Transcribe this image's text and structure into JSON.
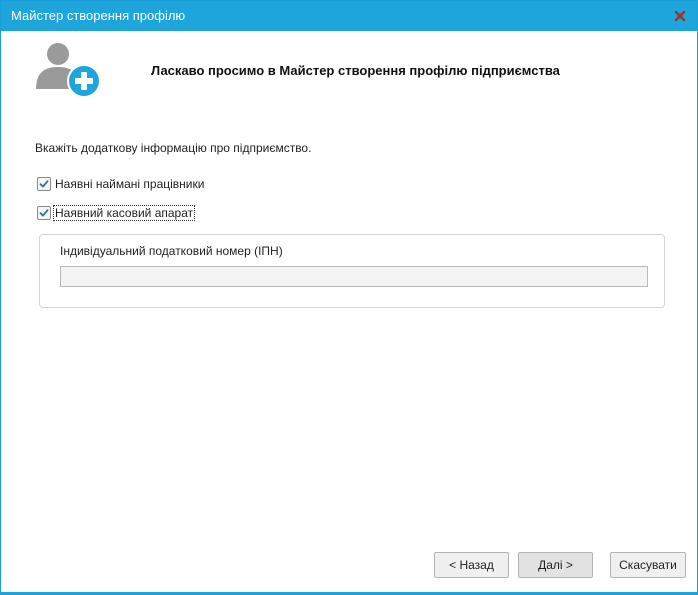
{
  "window": {
    "title": "Майстер створення профілю",
    "close_icon": "close-icon",
    "accent_color": "#1ea5dc",
    "close_color": "#b03030"
  },
  "header": {
    "icon": "add-user-icon",
    "title": "Ласкаво просимо в Майстер створення профілю підприємства"
  },
  "content": {
    "instruction": "Вкажіть додаткову інформацію про підприємство.",
    "checkboxes": [
      {
        "label": "Наявні наймані працівники",
        "checked": true
      },
      {
        "label": "Наявний касовий апарат",
        "checked": true,
        "focused": true
      }
    ],
    "ipn_group": {
      "label": "Індивідуальний податковий номер (ІПН)",
      "value": "",
      "placeholder": ""
    }
  },
  "buttons": {
    "back": "< Назад",
    "next": "Далі >",
    "cancel": "Скасувати"
  }
}
